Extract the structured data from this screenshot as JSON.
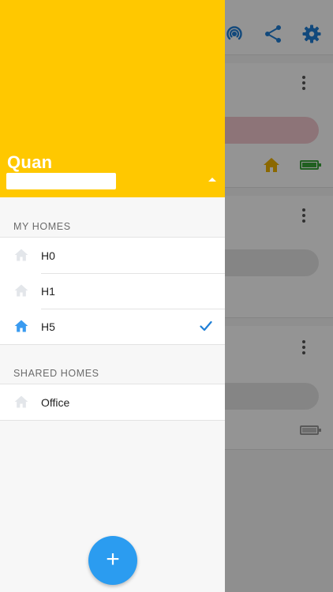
{
  "colors": {
    "header_yellow": "#ffc800",
    "accent_blue": "#2b9cf0",
    "icon_inactive": "#e3e6ea",
    "icon_active": "#3a9bf0"
  },
  "drawer": {
    "user_name": "Quan",
    "my_homes": {
      "title": "MY HOMES",
      "items": [
        {
          "label": "H0",
          "icon": "home-icon",
          "selected": false
        },
        {
          "label": "H1",
          "icon": "home-icon",
          "selected": false
        },
        {
          "label": "H5",
          "icon": "home-icon",
          "selected": true
        }
      ]
    },
    "shared_homes": {
      "title": "SHARED HOMES",
      "items": [
        {
          "label": "Office",
          "icon": "home-icon",
          "selected": false
        }
      ]
    },
    "fab_label": "+"
  },
  "background_app": {
    "icons": [
      "signal-icon",
      "share-icon",
      "settings-gear-icon"
    ]
  }
}
